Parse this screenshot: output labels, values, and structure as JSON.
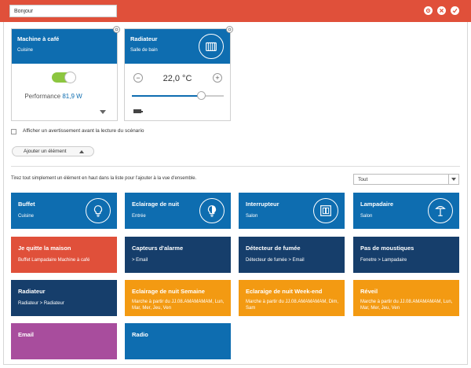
{
  "header": {
    "name_value": "Bonjour",
    "buttons": {
      "settings_icon": "gear-icon",
      "close_icon": "close-icon",
      "confirm_icon": "check-icon"
    }
  },
  "cards": [
    {
      "title": "Machine à café",
      "subtitle": "Cuisine",
      "perf_label": "Performance",
      "perf_value": "81,9 W"
    },
    {
      "title": "Radiateur",
      "subtitle": "Salle de bain",
      "temperature": "22,0 °C",
      "minus": "−",
      "plus": "+",
      "slider_level": 0.75
    }
  ],
  "options": {
    "warning_label": "Afficher un avertissement avant la lecture du scénario"
  },
  "add_button": {
    "label": "Ajouter un élément"
  },
  "list": {
    "hint": "Tirez tout simplement un élément en haut dans la liste pour l'ajouter à la vue d'ensemble.",
    "filter_value": "Tout"
  },
  "tiles": [
    {
      "title": "Buffet",
      "subtitle": "Cuisine"
    },
    {
      "title": "Eclairage de nuit",
      "subtitle": "Entrée"
    },
    {
      "title": "Interrupteur",
      "subtitle": "Salon"
    },
    {
      "title": "Lampadaire",
      "subtitle": "Salon"
    },
    {
      "title": "Je quitte la maison",
      "subtitle": "Buffet Lampadaire Machine à café"
    },
    {
      "title": "Capteurs d'alarme",
      "subtitle": "> Email"
    },
    {
      "title": "Détecteur de fumée",
      "subtitle": "Détecteur de fumée > Email"
    },
    {
      "title": "Pas de moustiques",
      "subtitle": "Fenetre > Lampadaire"
    },
    {
      "title": "Radiateur",
      "subtitle": "Radiateur > Radiateur"
    },
    {
      "title": "Eclairage de nuit Semaine",
      "subtitle": "Marche à partir du JJ.08.AMAMAMAM, Lun, Mar, Mer, Jeu, Ven"
    },
    {
      "title": "Eclaraige de nuit Week-end",
      "subtitle": "Marche à partir du JJ.08.AMAMAMAM, Dim, Sam"
    },
    {
      "title": "Réveil",
      "subtitle": "Marche à partir du JJ.08.AMAMAMAM, Lun, Mar, Mer, Jeu, Ven"
    },
    {
      "title": "Email",
      "subtitle": ""
    },
    {
      "title": "Radio",
      "subtitle": ""
    }
  ],
  "colors": {
    "accent_red": "#e0503a",
    "blue": "#0e6db0",
    "navy": "#163e6b",
    "orange": "#f39a12",
    "purple": "#a84d9d",
    "toggle_on": "#8cc63f"
  }
}
